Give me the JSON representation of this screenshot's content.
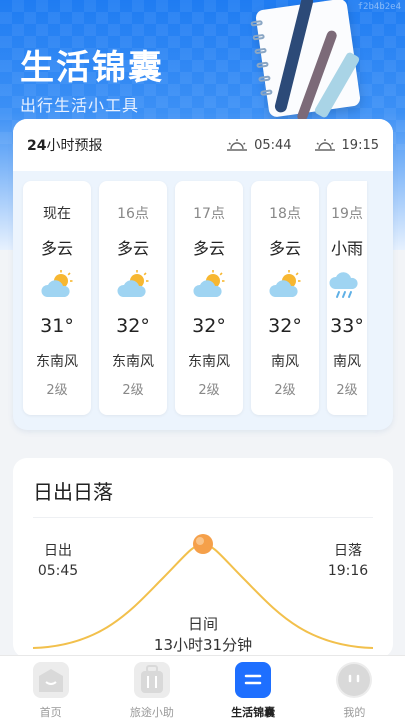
{
  "header": {
    "title": "生活锦囊",
    "subtitle": "出行生活小工具",
    "watermark": "f2b4b2e4"
  },
  "forecast": {
    "title_bold": "24",
    "title_rest": "小时预报",
    "sunrise_time": "05:44",
    "sunset_time": "19:15",
    "hours": [
      {
        "time": "现在",
        "condition": "多云",
        "icon": "partly-cloudy-icon",
        "temp": "31°",
        "wind": "东南风",
        "level": "2级"
      },
      {
        "time": "16点",
        "condition": "多云",
        "icon": "partly-cloudy-icon",
        "temp": "32°",
        "wind": "东南风",
        "level": "2级"
      },
      {
        "time": "17点",
        "condition": "多云",
        "icon": "partly-cloudy-icon",
        "temp": "32°",
        "wind": "东南风",
        "level": "2级"
      },
      {
        "time": "18点",
        "condition": "多云",
        "icon": "partly-cloudy-icon",
        "temp": "32°",
        "wind": "南风",
        "level": "2级"
      },
      {
        "time": "19点",
        "condition": "小雨",
        "icon": "light-rain-icon",
        "temp": "33°",
        "wind": "南风",
        "level": "2级"
      }
    ]
  },
  "sun": {
    "heading": "日出日落",
    "sunrise_label": "日出",
    "sunrise_time": "05:45",
    "sunset_label": "日落",
    "sunset_time": "19:16",
    "daytime_label": "日间",
    "daytime_value": "13小时31分钟"
  },
  "nav": {
    "items": [
      {
        "label": "首页",
        "icon": "home-icon"
      },
      {
        "label": "旅途小助",
        "icon": "luggage-icon"
      },
      {
        "label": "生活锦囊",
        "icon": "list-icon"
      },
      {
        "label": "我的",
        "icon": "profile-icon"
      }
    ],
    "active_index": 2
  },
  "colors": {
    "brand_blue": "#1e6fff",
    "sun_orange": "#f5a04a",
    "curve": "#f2c04c"
  }
}
